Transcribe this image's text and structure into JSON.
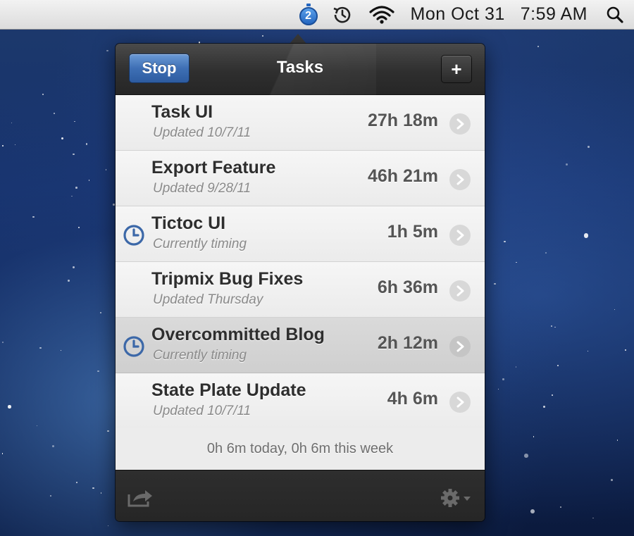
{
  "menubar": {
    "badge_count": "2",
    "day": "Mon",
    "date": "Oct 31",
    "time": "7:59 AM",
    "icons": [
      "tictoc-badge-icon",
      "time-machine-icon",
      "wifi-icon",
      "spotlight-search-icon"
    ]
  },
  "panel": {
    "stop_label": "Stop",
    "title": "Tasks",
    "add_label": "+"
  },
  "tasks": [
    {
      "name": "Task UI",
      "subtitle": "Updated 10/7/11",
      "time": "27h 18m",
      "timing": false,
      "selected": false
    },
    {
      "name": "Export Feature",
      "subtitle": "Updated 9/28/11",
      "time": "46h 21m",
      "timing": false,
      "selected": false
    },
    {
      "name": "Tictoc UI",
      "subtitle": "Currently timing",
      "time": "1h 5m",
      "timing": true,
      "selected": false
    },
    {
      "name": "Tripmix Bug Fixes",
      "subtitle": "Updated Thursday",
      "time": "6h 36m",
      "timing": false,
      "selected": false
    },
    {
      "name": "Overcommitted Blog",
      "subtitle": "Currently timing",
      "time": "2h 12m",
      "timing": true,
      "selected": true
    },
    {
      "name": "State Plate Update",
      "subtitle": "Updated 10/7/11",
      "time": "4h 6m",
      "timing": false,
      "selected": false
    }
  ],
  "summary": "0h 6m today, 0h 6m this week",
  "footer": {
    "share_icon": "share-icon",
    "gear_icon": "gear-icon"
  },
  "colors": {
    "accent_blue": "#3e6fb5",
    "timing_icon": "#3c68a8",
    "header_dark": "#2f2f2f"
  }
}
